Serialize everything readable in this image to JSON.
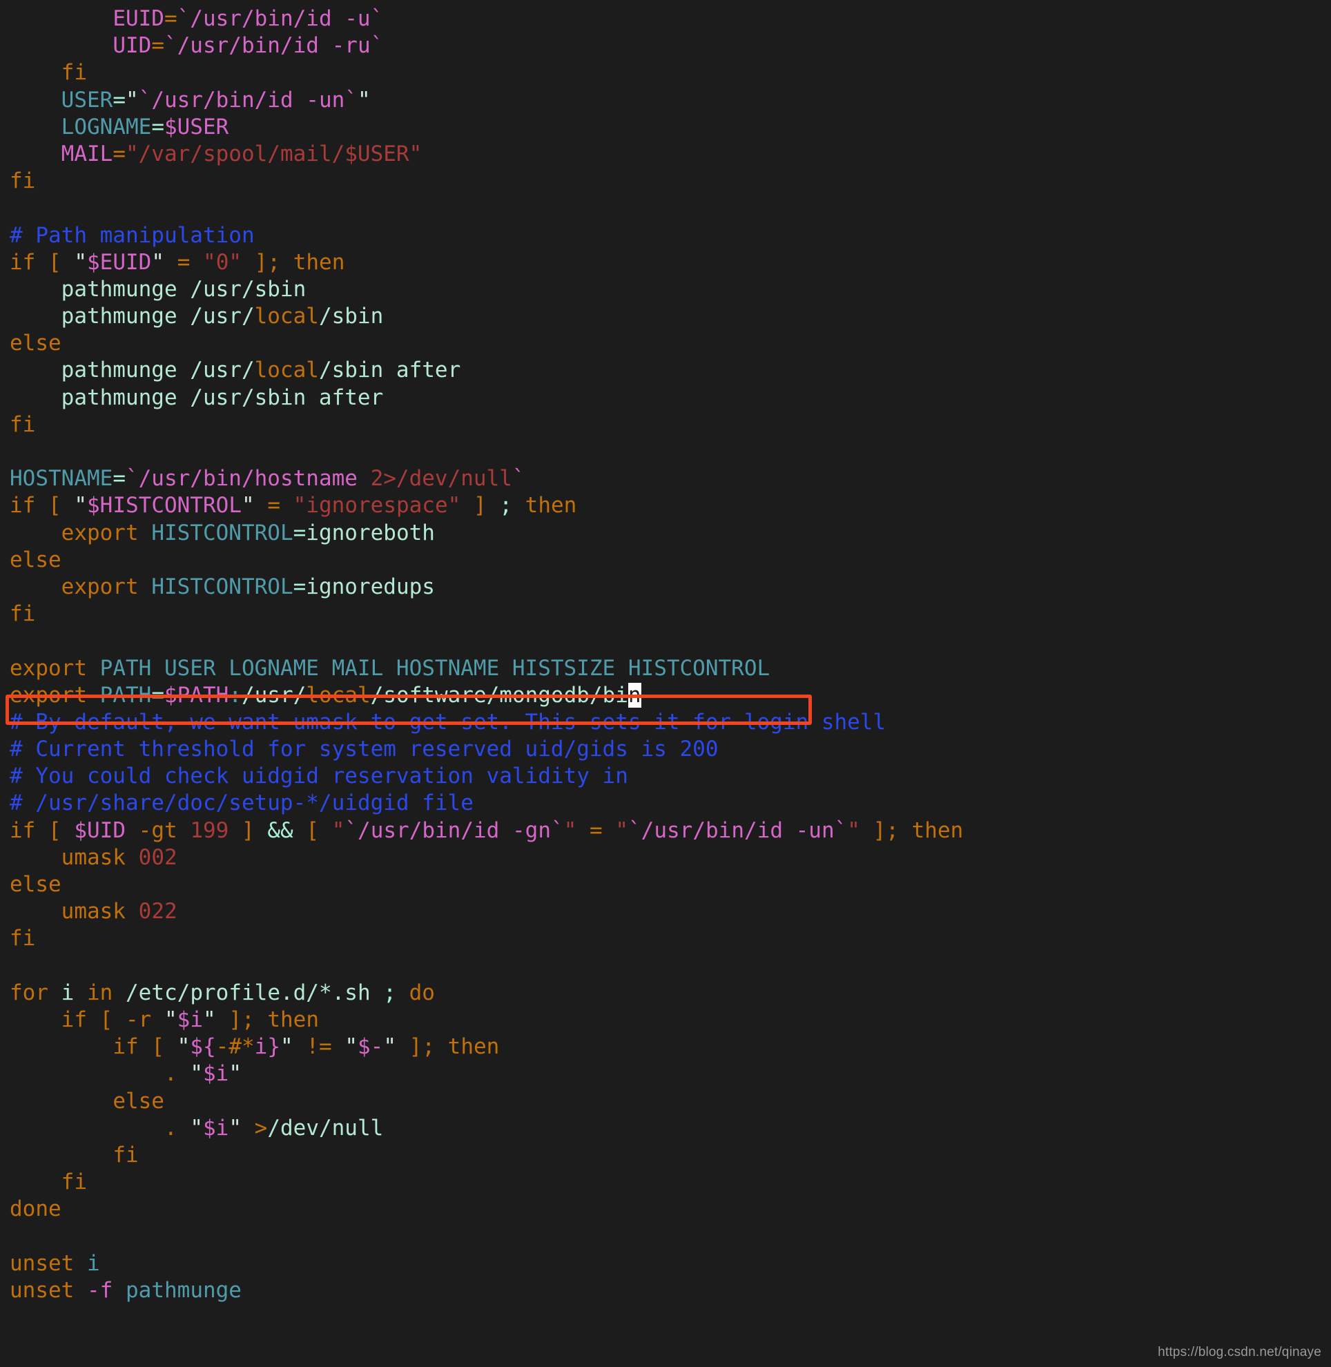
{
  "editor": {
    "background_color": "#1c1c1c",
    "file_kind": "shell-script",
    "colors": {
      "keyword": "#c2700a",
      "comment": "#2b49ea",
      "string_path": "#b5e9d2",
      "variable": "#d766c9",
      "assignment": "#4f9cab",
      "number": "#a93b38",
      "operator": "#a9f1d9",
      "cursor": "#ffffff",
      "highlight_box": "#f0451f"
    },
    "cursor": {
      "char": "n",
      "line_index": 26
    },
    "lines": [
      "        EUID=`/usr/bin/id -u`",
      "        UID=`/usr/bin/id -ru`",
      "    fi",
      "    USER=\"`/usr/bin/id -un`\"",
      "    LOGNAME=$USER",
      "    MAIL=\"/var/spool/mail/$USER\"",
      "fi",
      "",
      "# Path manipulation",
      "if [ \"$EUID\" = \"0\" ]; then",
      "    pathmunge /usr/sbin",
      "    pathmunge /usr/local/sbin",
      "else",
      "    pathmunge /usr/local/sbin after",
      "    pathmunge /usr/sbin after",
      "fi",
      "",
      "HOSTNAME=`/usr/bin/hostname 2>/dev/null`",
      "if [ \"$HISTCONTROL\" = \"ignorespace\" ] ; then",
      "    export HISTCONTROL=ignoreboth",
      "else",
      "    export HISTCONTROL=ignoredups",
      "fi",
      "",
      "export PATH USER LOGNAME MAIL HOSTNAME HISTSIZE HISTCONTROL",
      "export PATH=$PATH:/usr/local/software/mongodb/bin",
      "# By default, we want umask to get set. This sets it for login shell",
      "# Current threshold for system reserved uid/gids is 200",
      "# You could check uidgid reservation validity in",
      "# /usr/share/doc/setup-*/uidgid file",
      "if [ $UID -gt 199 ] && [ \"`/usr/bin/id -gn`\" = \"`/usr/bin/id -un`\" ]; then",
      "    umask 002",
      "else",
      "    umask 022",
      "fi",
      "",
      "for i in /etc/profile.d/*.sh ; do",
      "    if [ -r \"$i\" ]; then",
      "        if [ \"${-#*i}\" != \"$-\" ]; then",
      "            . \"$i\"",
      "        else",
      "            . \"$i\" >/dev/null",
      "        fi",
      "    fi",
      "done",
      "",
      "unset i",
      "unset -f pathmunge"
    ]
  },
  "annotation": {
    "type": "rectangle",
    "color": "#f0451f",
    "target_line": "export PATH=$PATH:/usr/local/software/mongodb/bin"
  },
  "watermark": {
    "text": "https://blog.csdn.net/qinaye"
  }
}
